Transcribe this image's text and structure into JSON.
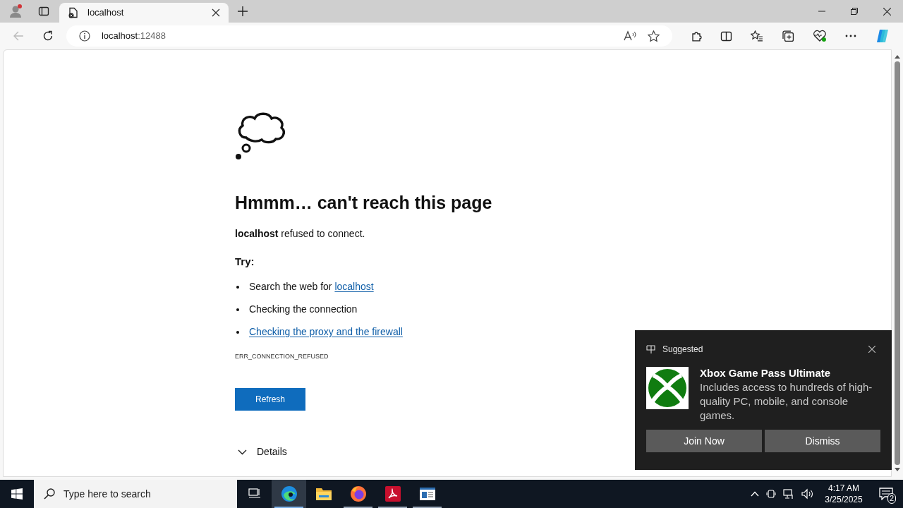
{
  "browser": {
    "tab": {
      "title": "localhost",
      "selected": true
    },
    "address": {
      "host": "localhost",
      "port": ":12488"
    }
  },
  "error_page": {
    "heading": "Hmmm… can't reach this page",
    "message": "**localhost** refused to connect.",
    "try_label": "Try:",
    "suggestions": [
      {
        "parts": [
          {
            "text": "Search the web for ",
            "link": false
          },
          {
            "text": "localhost",
            "link": true
          }
        ]
      },
      {
        "parts": [
          {
            "text": "Checking the connection",
            "link": false
          }
        ]
      },
      {
        "parts": [
          {
            "text": "Checking the proxy and the firewall",
            "link": true
          }
        ]
      }
    ],
    "error_code": "ERR_CONNECTION_REFUSED",
    "refresh_button": "Refresh",
    "details": "Details"
  },
  "notification": {
    "header": "Suggested",
    "title": "Xbox Game Pass Ultimate",
    "body": "Includes access to hundreds of high-quality PC, mobile, and console games.",
    "buttons": [
      "Join Now",
      "Dismiss"
    ]
  },
  "taskbar": {
    "search_placeholder": "Type here to search",
    "apps": [
      {
        "kind": "taskview",
        "active": false,
        "running": false
      },
      {
        "kind": "edge",
        "active": true,
        "running": true
      },
      {
        "kind": "folder",
        "active": false,
        "running": false
      },
      {
        "kind": "firefox",
        "active": false,
        "running": true
      },
      {
        "kind": "pdf",
        "active": false,
        "running": true
      },
      {
        "kind": "window",
        "active": false,
        "running": true
      }
    ],
    "time": "4:17 AM",
    "date": "3/25/2025",
    "notification_count": "2"
  }
}
